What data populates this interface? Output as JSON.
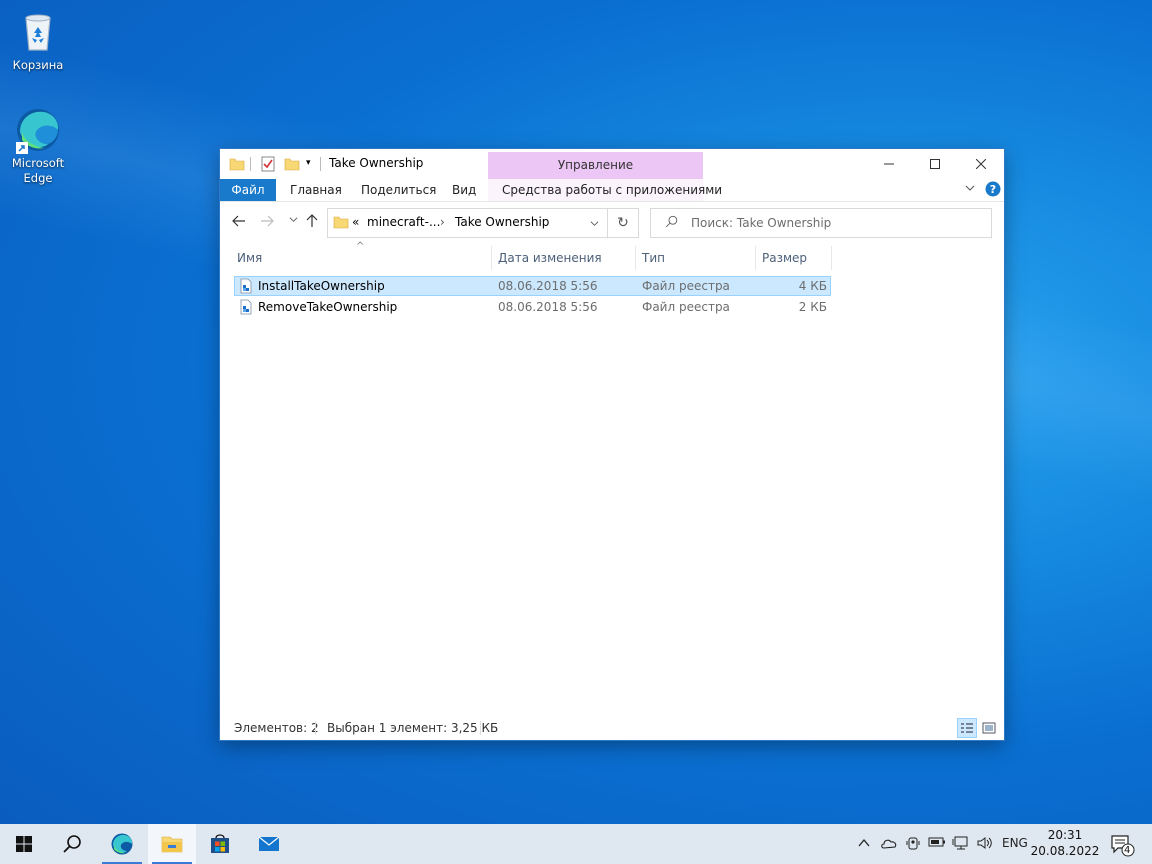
{
  "desktop": {
    "icons": [
      {
        "label": "Корзина"
      },
      {
        "label": "Microsoft Edge"
      }
    ]
  },
  "window": {
    "title": "Take Ownership",
    "context_header": "Управление",
    "ribbon_tabs": [
      "Файл",
      "Главная",
      "Поделиться",
      "Вид",
      "Средства работы с приложениями"
    ],
    "controls": {
      "minimize": "—",
      "maximize": "☐",
      "close": "✕"
    },
    "address": {
      "overflow": "«",
      "segments": [
        "minecraft-...",
        "Take Ownership"
      ]
    },
    "search": {
      "placeholder": "Поиск: Take Ownership"
    },
    "columns": [
      "Имя",
      "Дата изменения",
      "Тип",
      "Размер"
    ],
    "files": [
      {
        "name": "InstallTakeOwnership",
        "date": "08.06.2018 5:56",
        "type": "Файл реестра",
        "size": "4 КБ",
        "selected": true
      },
      {
        "name": "RemoveTakeOwnership",
        "date": "08.06.2018 5:56",
        "type": "Файл реестра",
        "size": "2 КБ",
        "selected": false
      }
    ],
    "status": {
      "count": "Элементов: 2",
      "selection": "Выбран 1 элемент: 3,25 КБ"
    }
  },
  "taskbar": {
    "language": "ENG",
    "time": "20:31",
    "date": "20.08.2022",
    "notifications": "4"
  },
  "colors": {
    "accent": "#1979ca",
    "selection": "#cce8ff",
    "context": "#ecc6f4"
  }
}
